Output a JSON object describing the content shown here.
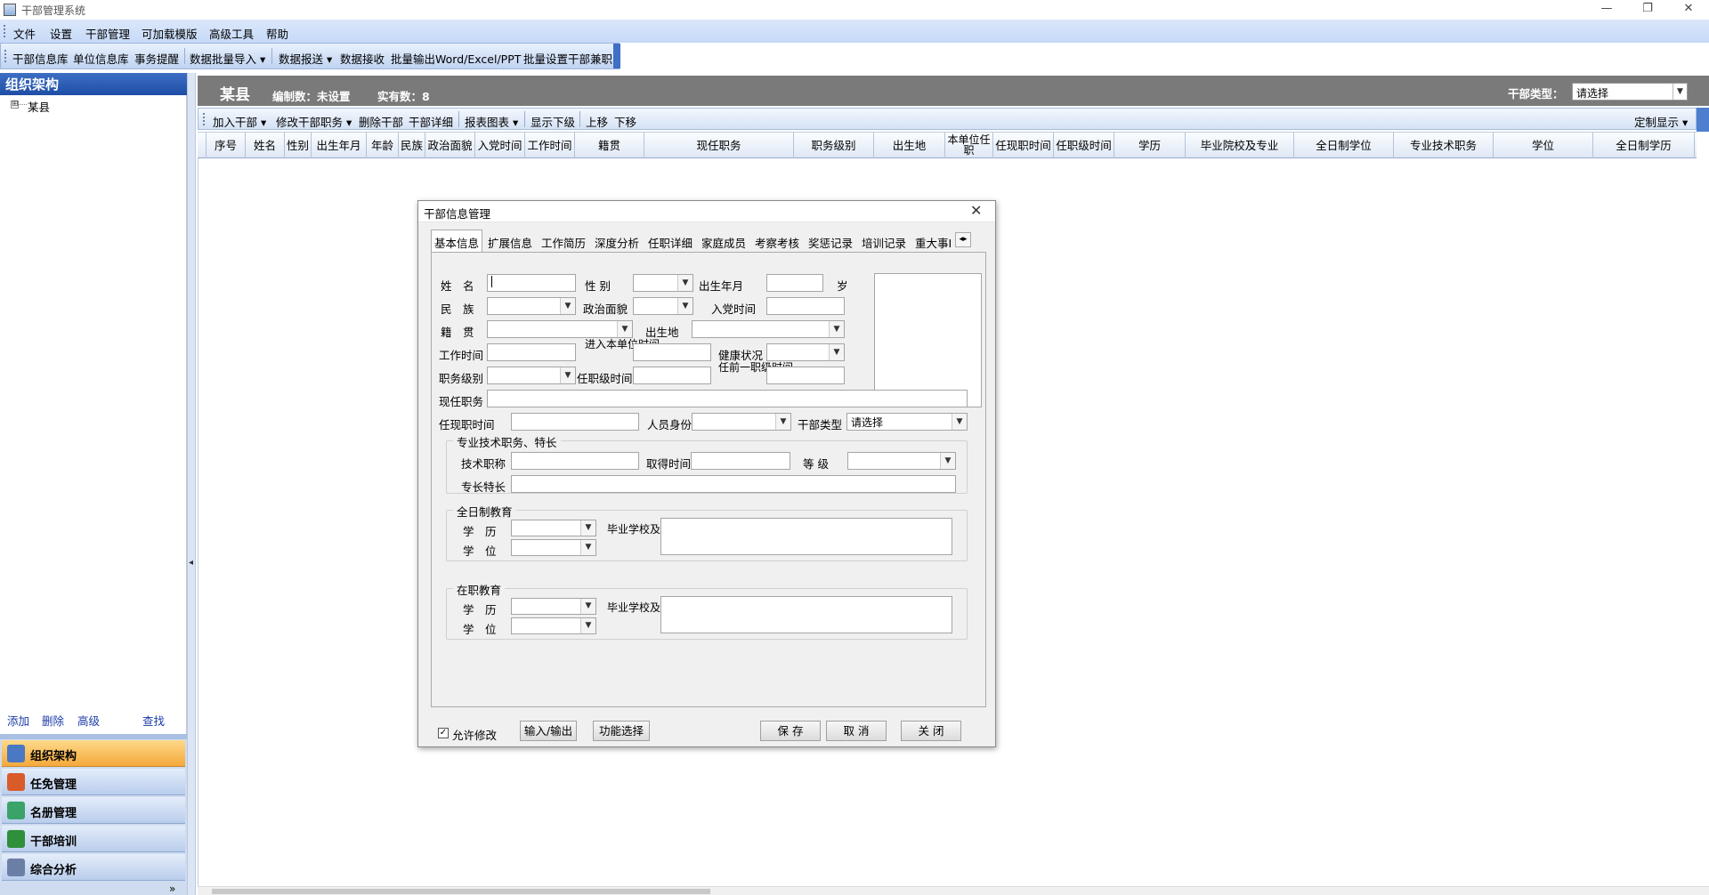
{
  "window": {
    "title": "干部管理系统",
    "minimize": "—",
    "restore": "❐",
    "close": "✕"
  },
  "menu": [
    "文件",
    "设置",
    "干部管理",
    "可加载模版",
    "高级工具",
    "帮助"
  ],
  "toolbar": [
    "干部信息库",
    "单位信息库",
    "事务提醒",
    "数据批量导入",
    "数据报送",
    "数据接收",
    "批量输出Word/Excel/PPT",
    "批量设置干部兼职"
  ],
  "left": {
    "title": "组织架构",
    "tree_expand": "⊞",
    "tree_root": "某县",
    "links": [
      "添加",
      "删除",
      "高级",
      "查找"
    ],
    "nav": [
      "组织架构",
      "任免管理",
      "名册管理",
      "干部培训",
      "综合分析"
    ],
    "more": "»"
  },
  "header": {
    "county": "某县",
    "quota": "编制数：未设置",
    "actual": "实有数：8",
    "type_label": "干部类型：",
    "type_value": "请选择"
  },
  "actions": [
    "加入干部",
    "修改干部职务",
    "删除干部",
    "干部详细",
    "报表图表",
    "显示下级",
    "上移",
    "下移"
  ],
  "custom_display": "定制显示",
  "grid_columns": [
    "序号",
    "姓名",
    "性别",
    "出生年月",
    "年龄",
    "民族",
    "政治面貌",
    "入党时间",
    "工作时间",
    "籍贯",
    "现任职务",
    "职务级别",
    "出生地",
    "本单位任职",
    "任现职时间",
    "任职级时间",
    "学历",
    "毕业院校及专业",
    "全日制学位",
    "专业技术职务",
    "学位",
    "全日制学历"
  ],
  "dialog": {
    "title": "干部信息管理",
    "close": "✕",
    "tabs": [
      "基本信息",
      "扩展信息",
      "工作简历",
      "深度分析",
      "任职详细",
      "家庭成员",
      "考察考核",
      "奖惩记录",
      "培训记录",
      "重大事I"
    ],
    "tab_arrows": "◂▸",
    "fields": {
      "name": "姓　名",
      "sex": "性 别",
      "birth": "出生年月",
      "age_unit": "岁",
      "ethnic": "民　族",
      "politics": "政治面貌",
      "party": "入党时间",
      "native": "籍　贯",
      "birthplace": "出生地",
      "work": "工作时间",
      "enter_unit": "进入本单位时间",
      "health": "健康状况",
      "rank": "职务级别",
      "rank_time": "任职级时间",
      "prev_rank_time": "任前一职级时间",
      "position": "现任职务",
      "pos_time": "任现职时间",
      "identity": "人员身份",
      "cadre_type": "干部类型",
      "cadre_type_value": "请选择"
    },
    "group_pro": {
      "title": "专业技术职务、特长",
      "tech": "技术职称",
      "get_time": "取得时间",
      "level": "等 级",
      "specialty": "专长特长"
    },
    "group_fulltime": {
      "title": "全日制教育",
      "edu": "学　历",
      "degree": "学　位",
      "school": "毕业学校及专业"
    },
    "group_parttime": {
      "title": "在职教育",
      "edu": "学　历",
      "degree": "学　位",
      "school": "毕业学校及专业"
    },
    "allow_edit": "允许修改",
    "allow_edit_checked": "✓",
    "buttons": {
      "io": "输入/输出",
      "func": "功能选择",
      "save": "保 存",
      "cancel": "取 消",
      "close": "关 闭"
    }
  }
}
